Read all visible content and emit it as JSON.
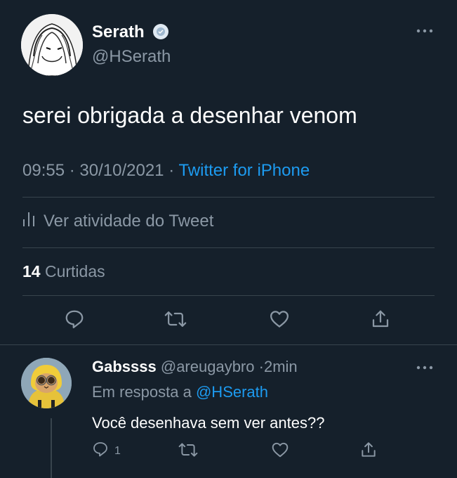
{
  "tweet": {
    "author_name": "Serath",
    "author_handle": "@HSerath",
    "text": "serei obrigada a desenhar venom",
    "time": "09:55",
    "separator": "·",
    "date": "30/10/2021",
    "source": "Twitter for iPhone",
    "activity_label": "Ver atividade do Tweet",
    "likes_count": "14",
    "likes_label": "Curtidas"
  },
  "reply": {
    "author_name": "Gabssss",
    "author_handle": "@areugaybro",
    "separator": "·",
    "time_ago": "2min",
    "reply_to_label": "Em resposta a",
    "reply_to_handle": "@HSerath",
    "text": "Você desenhava sem ver antes??",
    "reply_count": "1"
  },
  "icons": [
    "more-icon",
    "reply-icon",
    "retweet-icon",
    "like-icon",
    "share-icon",
    "activity-icon",
    "verified-badge-icon"
  ],
  "colors": {
    "background": "#15202b",
    "text_primary": "#ffffff",
    "text_secondary": "#8b98a5",
    "accent": "#1d9bf0",
    "divider": "#38444d"
  }
}
